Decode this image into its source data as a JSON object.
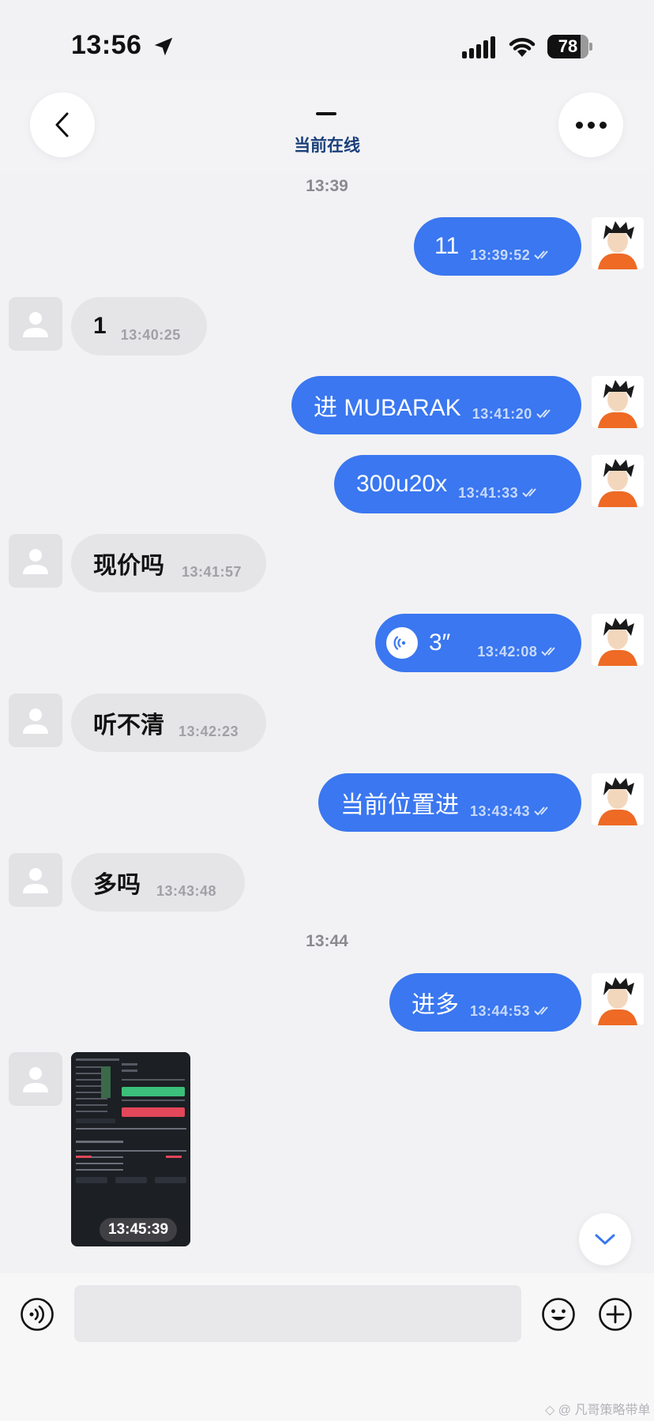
{
  "status_bar": {
    "time": "13:56",
    "battery": "78"
  },
  "header": {
    "title_dash": "—",
    "status": "当前在线"
  },
  "time_separators": [
    "13:39",
    "13:44"
  ],
  "messages": [
    {
      "dir": "out",
      "text": "11",
      "time": "13:39:52"
    },
    {
      "dir": "in",
      "text": "1",
      "time": "13:40:25"
    },
    {
      "dir": "out",
      "text": "进 MUBARAK",
      "time": "13:41:20"
    },
    {
      "dir": "out",
      "text": "300u20x",
      "time": "13:41:33"
    },
    {
      "dir": "in",
      "text": "现价吗",
      "time": "13:41:57"
    },
    {
      "dir": "out",
      "type": "voice",
      "text": "3″",
      "time": "13:42:08"
    },
    {
      "dir": "in",
      "text": "听不清",
      "time": "13:42:23"
    },
    {
      "dir": "out",
      "text": "当前位置进",
      "time": "13:43:43"
    },
    {
      "dir": "in",
      "text": "多吗",
      "time": "13:43:48"
    },
    {
      "dir": "out",
      "text": "进多",
      "time": "13:44:53"
    },
    {
      "dir": "in",
      "type": "image",
      "time": "13:45:39"
    }
  ],
  "watermark": "◇ @ 凡哥策略带单",
  "colors": {
    "out_bubble": "#3a77f0",
    "in_bubble": "#e5e5e8",
    "header_status": "#1a3f7a"
  }
}
